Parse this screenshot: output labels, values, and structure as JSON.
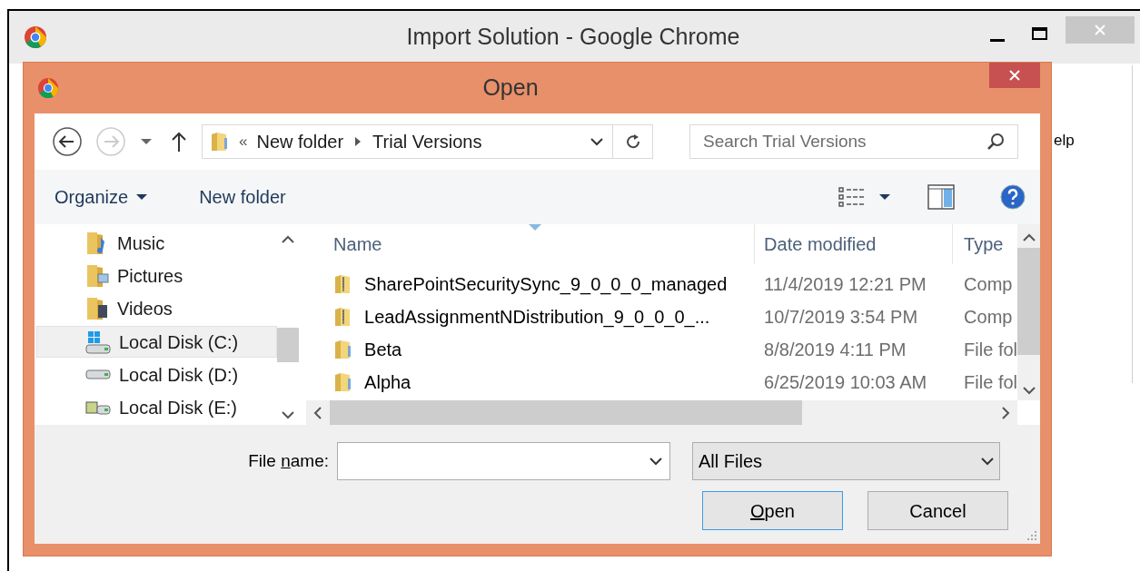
{
  "browser_window": {
    "title": "Import Solution - Google Chrome",
    "behind_text": "elp"
  },
  "dialog": {
    "title": "Open",
    "address": {
      "overflow": "«",
      "path": [
        "New folder",
        "Trial Versions"
      ]
    },
    "search": {
      "placeholder": "Search Trial Versions"
    },
    "toolbar": [
      "Organize",
      "New folder"
    ],
    "nav_items": [
      {
        "label": "Music",
        "kind": "music",
        "selected": false
      },
      {
        "label": "Pictures",
        "kind": "pictures",
        "selected": false
      },
      {
        "label": "Videos",
        "kind": "videos",
        "selected": false
      },
      {
        "label": "Local Disk (C:)",
        "kind": "system-disk",
        "selected": true
      },
      {
        "label": "Local Disk (D:)",
        "kind": "disk",
        "selected": false
      },
      {
        "label": "Local Disk (E:)",
        "kind": "network-disk",
        "selected": false
      }
    ],
    "columns": [
      "Name",
      "Date modified",
      "Type"
    ],
    "rows": [
      {
        "name": "SharePointSecuritySync_9_0_0_0_managed",
        "date": "11/4/2019 12:21 PM",
        "type": "Comp",
        "kind": "zip"
      },
      {
        "name": "LeadAssignmentNDistribution_9_0_0_0_...",
        "date": "10/7/2019 3:54 PM",
        "type": "Comp",
        "kind": "zip"
      },
      {
        "name": "Beta",
        "date": "8/8/2019 4:11 PM",
        "type": "File fol",
        "kind": "folder"
      },
      {
        "name": "Alpha",
        "date": "6/25/2019 10:03 AM",
        "type": "File fol",
        "kind": "folder"
      }
    ],
    "file_name": {
      "label_before": "File ",
      "access_key": "n",
      "label_after": "ame:"
    },
    "filter": "All Files",
    "buttons": [
      {
        "access_key": "O",
        "after": "pen",
        "kind": "default"
      },
      {
        "before": "Cancel",
        "kind": "normal"
      }
    ]
  }
}
